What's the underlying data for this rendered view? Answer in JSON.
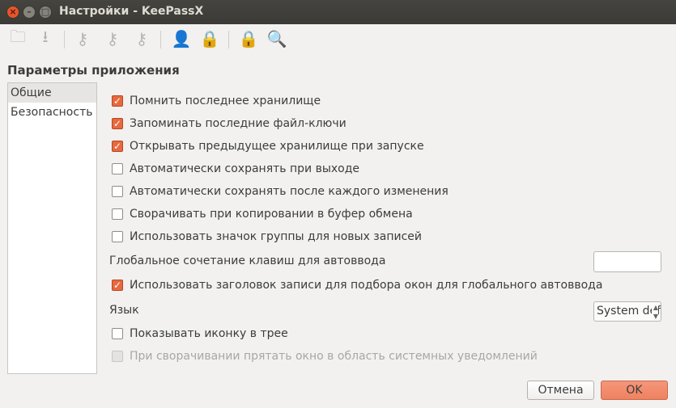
{
  "window": {
    "title": "Настройки - KeePassX"
  },
  "toolbar": [
    {
      "icon": "open-database-icon"
    },
    {
      "icon": "save-database-icon"
    },
    {
      "icon": "add-entry-icon"
    },
    {
      "icon": "edit-entry-icon"
    },
    {
      "icon": "delete-entry-icon"
    },
    {
      "icon": "copy-username-icon"
    },
    {
      "icon": "copy-password-icon"
    },
    {
      "icon": "lock-icon"
    },
    {
      "icon": "search-icon"
    }
  ],
  "heading": "Параметры приложения",
  "sidebar": {
    "items": [
      {
        "label": "Общие",
        "selected": true
      },
      {
        "label": "Безопасность",
        "selected": false
      }
    ]
  },
  "options": [
    {
      "label": "Помнить последнее хранилище",
      "checked": true
    },
    {
      "label": "Запоминать последние файл-ключи",
      "checked": true
    },
    {
      "label": "Открывать предыдущее хранилище при запуске",
      "checked": true
    },
    {
      "label": "Автоматически сохранять при выходе",
      "checked": false
    },
    {
      "label": "Автоматически сохранять после каждого изменения",
      "checked": false
    },
    {
      "label": "Сворачивать при копировании в буфер обмена",
      "checked": false
    },
    {
      "label": "Использовать значок группы для новых записей",
      "checked": false
    }
  ],
  "global_shortcut": {
    "label": "Глобальное сочетание клавиш для автоввода",
    "value": ""
  },
  "use_title": {
    "label": "Использовать заголовок записи для подбора окон для глобального автоввода",
    "checked": true
  },
  "language": {
    "label": "Язык",
    "value": "System default"
  },
  "tray": {
    "label": "Показывать иконку в трее",
    "checked": false
  },
  "minimize_tray": {
    "label": "При сворачивании прятать окно в область системных уведомлений",
    "checked": false,
    "disabled": true
  },
  "buttons": {
    "cancel": "Отмена",
    "ok": "OK"
  },
  "colors": {
    "accent": "#e8693f",
    "titlebar": "#3c3b37"
  }
}
